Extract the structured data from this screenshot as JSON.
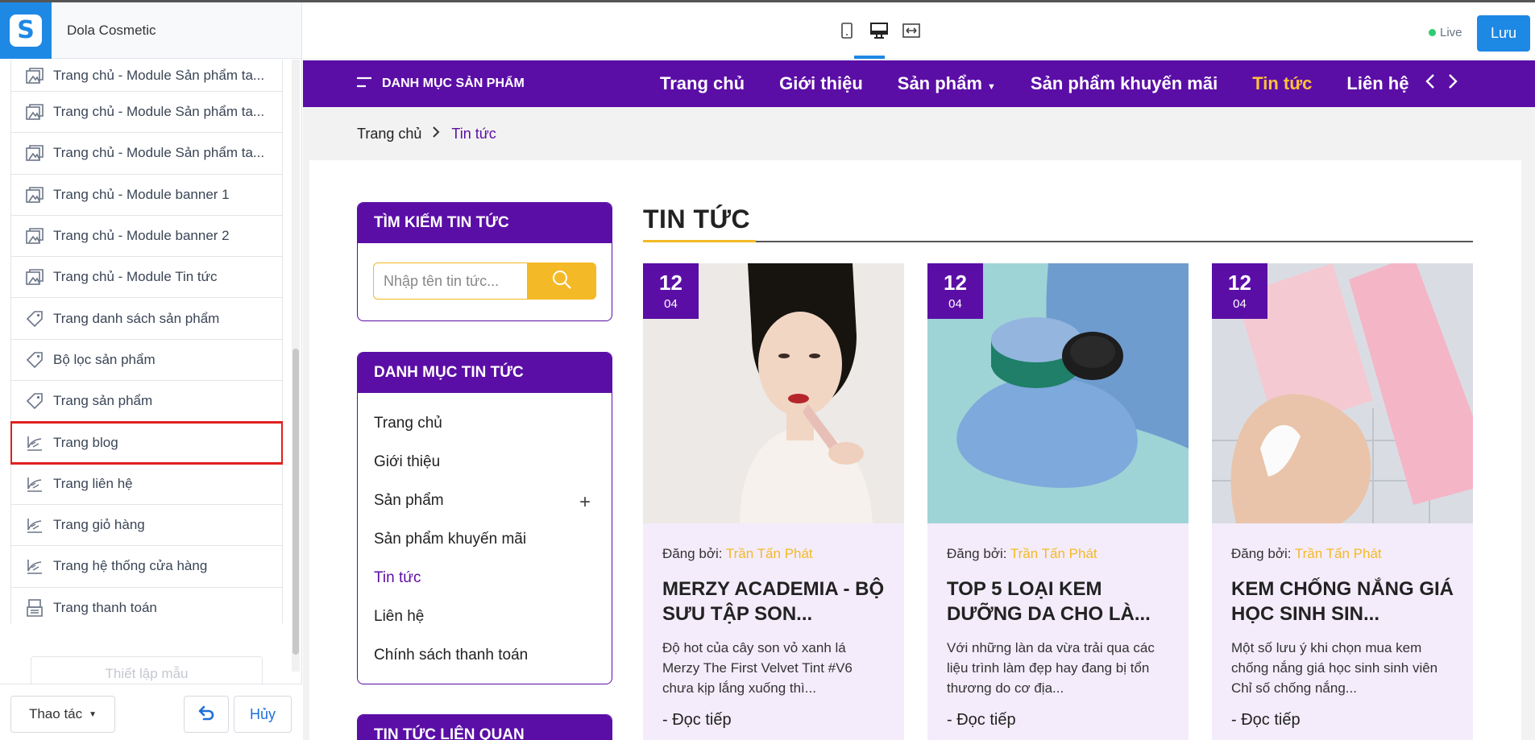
{
  "editor": {
    "store_name": "Dola Cosmetic",
    "templates": [
      {
        "label": "Trang chủ - Module Sản phẩm ta...",
        "icon": "image-icon"
      },
      {
        "label": "Trang chủ - Module Sản phẩm ta...",
        "icon": "image-icon"
      },
      {
        "label": "Trang chủ - Module Sản phẩm ta...",
        "icon": "image-icon"
      },
      {
        "label": "Trang chủ - Module banner 1",
        "icon": "image-icon"
      },
      {
        "label": "Trang chủ - Module banner 2",
        "icon": "image-icon"
      },
      {
        "label": "Trang chủ - Module Tin tức",
        "icon": "image-icon"
      },
      {
        "label": "Trang danh sách sản phẩm",
        "icon": "tag-icon"
      },
      {
        "label": "Bộ lọc sản phẩm",
        "icon": "tag-icon"
      },
      {
        "label": "Trang sản phẩm",
        "icon": "tag-icon"
      },
      {
        "label": "Trang blog",
        "icon": "blog-icon",
        "selected": true
      },
      {
        "label": "Trang liên hệ",
        "icon": "blog-icon"
      },
      {
        "label": "Trang giỏ hàng",
        "icon": "blog-icon"
      },
      {
        "label": "Trang hệ thống cửa hàng",
        "icon": "blog-icon"
      },
      {
        "label": "Trang thanh toán",
        "icon": "register-icon"
      }
    ],
    "setup_label": "Thiết lập mẫu",
    "action_label": "Thao tác",
    "cancel_label": "Hủy"
  },
  "toolbar": {
    "live_label": "Live",
    "save_label": "Lưu",
    "accent": "#1e88e5"
  },
  "site": {
    "brand_color": "#5b0ea6",
    "accent_color": "#ffc13b",
    "menu_label": "DANH MỤC SẢN PHẨM",
    "nav": [
      "Trang chủ",
      "Giới thiệu",
      "Sản phẩm",
      "Sản phẩm khuyến mãi",
      "Tin tức",
      "Liên hệ"
    ],
    "breadcrumb": {
      "home": "Trang chủ",
      "current": "Tin tức"
    },
    "search_box": {
      "title": "TÌM KIẾM TIN TỨC",
      "placeholder": "Nhập tên tin tức..."
    },
    "category_box": {
      "title": "DANH MỤC TIN TỨC",
      "items": [
        "Trang chủ",
        "Giới thiệu",
        "Sản phẩm",
        "Sản phẩm khuyến mãi",
        "Tin tức",
        "Liên hệ",
        "Chính sách thanh toán"
      ]
    },
    "related_box_title": "TIN TỨC LIÊN QUAN",
    "news_heading": "TIN TỨC",
    "articles": [
      {
        "day": "12",
        "month": "04",
        "by_label": "Đăng bởi:",
        "author": "Trần Tấn Phát",
        "title": "MERZY ACADEMIA - BỘ SƯU TẬP SON...",
        "excerpt": "Độ hot của cây son vỏ xanh lá Merzy The First Velvet Tint #V6 chưa kịp lắng xuống thì...",
        "more": "Đọc tiếp"
      },
      {
        "day": "12",
        "month": "04",
        "by_label": "Đăng bởi:",
        "author": "Trần Tấn Phát",
        "title": "TOP 5 LOẠI KEM DƯỠNG DA CHO LÀ...",
        "excerpt": "Với những làn da vừa trải qua các liệu trình làm đẹp hay đang bị tổn thương do cơ địa...",
        "more": "Đọc tiếp"
      },
      {
        "day": "12",
        "month": "04",
        "by_label": "Đăng bởi:",
        "author": "Trần Tấn Phát",
        "title": "KEM CHỐNG NẮNG GIÁ HỌC SINH SIN...",
        "excerpt": "Một số lưu ý khi chọn mua kem chống nắng giá học sinh sinh viên Chỉ số chống nắng...",
        "more": "Đọc tiếp"
      }
    ]
  }
}
